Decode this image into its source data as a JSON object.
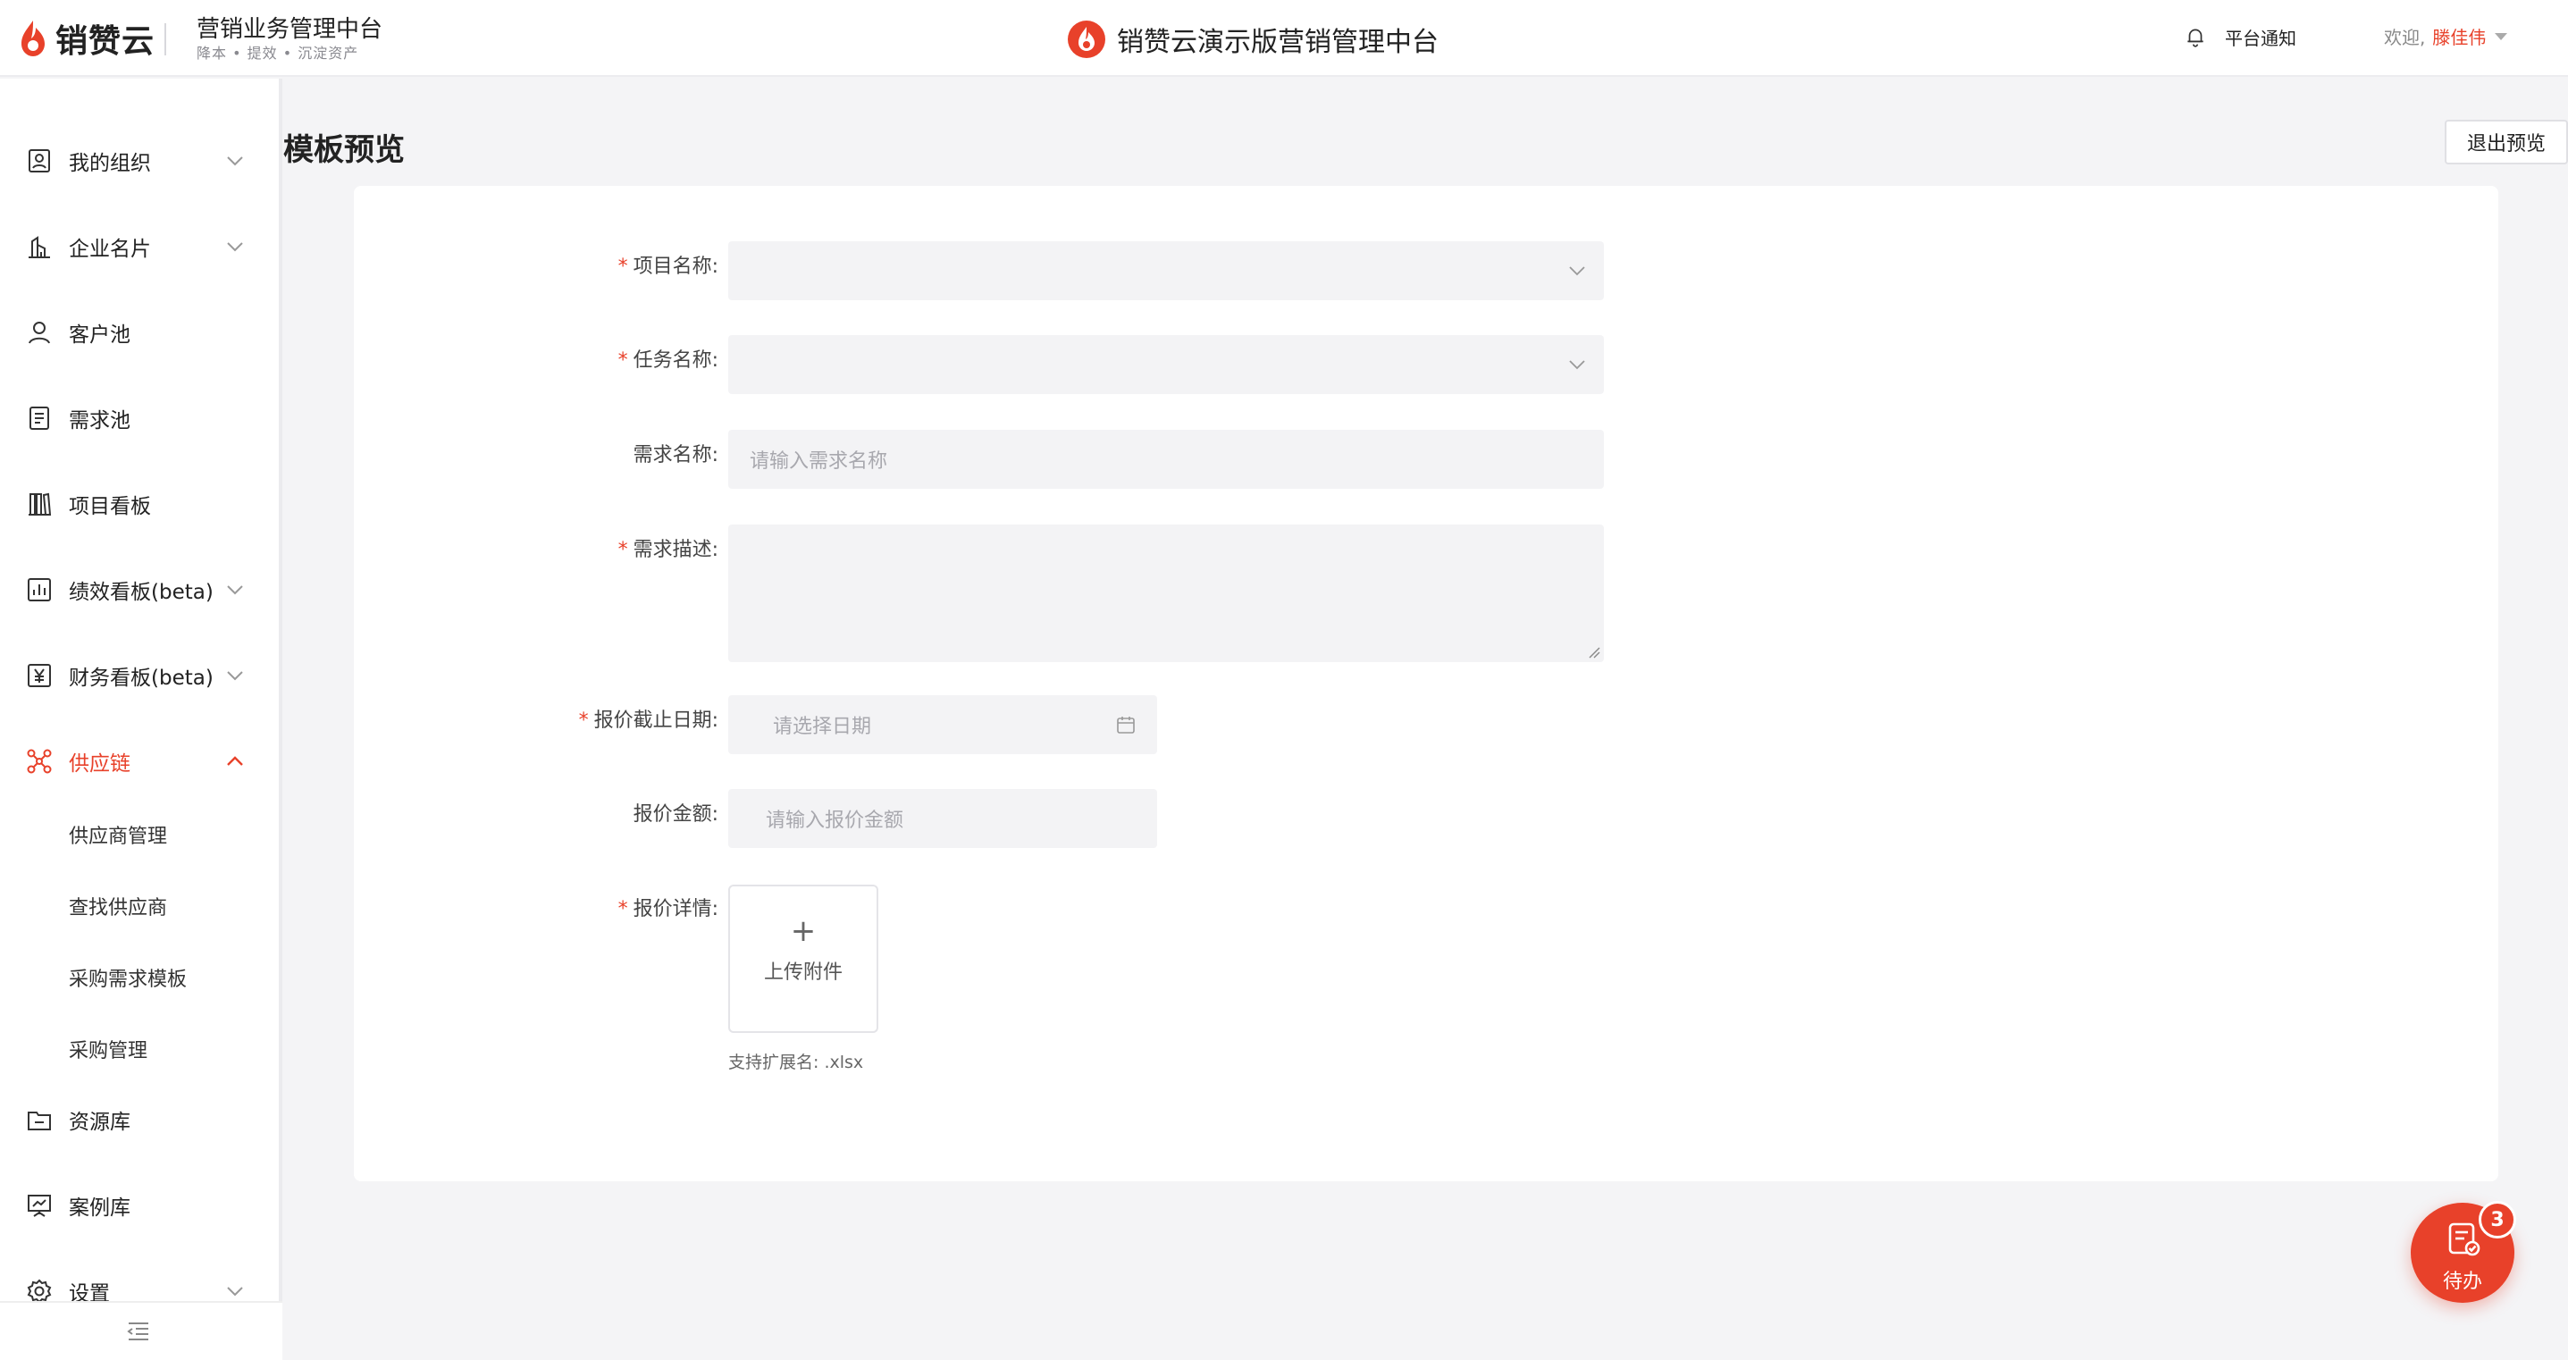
{
  "header": {
    "brand_name": "销赞云",
    "system_title": "营销业务管理中台",
    "system_subtitle": "降本 • 提效 • 沉淀资产",
    "center_title": "销赞云演示版营销管理中台",
    "notify_label": "平台通知",
    "welcome_label": "欢迎,",
    "user_name": "滕佳伟"
  },
  "sidebar": {
    "items": [
      {
        "label": "我的组织",
        "icon": "org-icon",
        "expandable": true
      },
      {
        "label": "企业名片",
        "icon": "building-icon",
        "expandable": true
      },
      {
        "label": "客户池",
        "icon": "user-icon",
        "expandable": false
      },
      {
        "label": "需求池",
        "icon": "document-icon",
        "expandable": false
      },
      {
        "label": "项目看板",
        "icon": "kanban-icon",
        "expandable": false
      },
      {
        "label": "绩效看板(beta)",
        "icon": "chart-icon",
        "expandable": true
      },
      {
        "label": "财务看板(beta)",
        "icon": "yen-icon",
        "expandable": true
      },
      {
        "label": "供应链",
        "icon": "supply-chain-icon",
        "expandable": true,
        "expanded": true,
        "active": true
      },
      {
        "label": "资源库",
        "icon": "folder-icon",
        "expandable": false
      },
      {
        "label": "案例库",
        "icon": "presentation-icon",
        "expandable": false
      },
      {
        "label": "设置",
        "icon": "gear-icon",
        "expandable": true
      }
    ],
    "sub_items": [
      "供应商管理",
      "查找供应商",
      "采购需求模板",
      "采购管理"
    ]
  },
  "page": {
    "title": "模板预览",
    "exit_label": "退出预览"
  },
  "form": {
    "project_label": "项目名称:",
    "task_label": "任务名称:",
    "demand_name_label": "需求名称:",
    "demand_name_placeholder": "请输入需求名称",
    "demand_desc_label": "需求描述:",
    "deadline_label": "报价截止日期:",
    "deadline_placeholder": "请选择日期",
    "amount_label": "报价金额:",
    "amount_placeholder": "请输入报价金额",
    "detail_label": "报价详情:",
    "upload_plus": "+",
    "upload_label": "上传附件",
    "upload_hint": "支持扩展名: .xlsx",
    "required_mark": "*"
  },
  "todo": {
    "label": "待办",
    "count": "3"
  },
  "colors": {
    "accent": "#e8412a",
    "field_bg": "#f3f3f5",
    "page_bg": "#f4f4f6"
  }
}
